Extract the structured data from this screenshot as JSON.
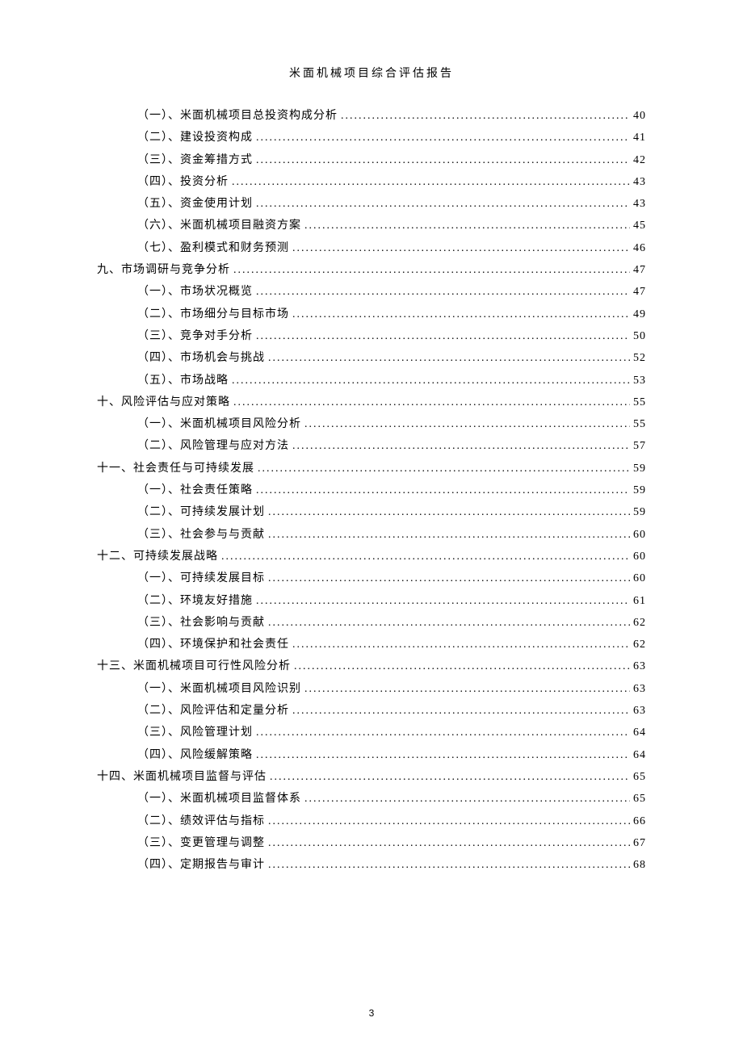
{
  "header": {
    "title": "米面机械项目综合评估报告"
  },
  "pageNumber": "3",
  "toc": [
    {
      "level": 2,
      "label": "（一）、米面机械项目总投资构成分析",
      "page": "40"
    },
    {
      "level": 2,
      "label": "（二）、建设投资构成",
      "page": "41"
    },
    {
      "level": 2,
      "label": "（三）、资金筹措方式",
      "page": "42"
    },
    {
      "level": 2,
      "label": "（四）、投资分析",
      "page": "43"
    },
    {
      "level": 2,
      "label": "（五）、资金使用计划",
      "page": "43"
    },
    {
      "level": 2,
      "label": "（六）、米面机械项目融资方案",
      "page": "45"
    },
    {
      "level": 2,
      "label": "（七）、盈利模式和财务预测",
      "page": "46"
    },
    {
      "level": 1,
      "label": "九、市场调研与竞争分析",
      "page": "47"
    },
    {
      "level": 2,
      "label": "（一）、市场状况概览",
      "page": "47"
    },
    {
      "level": 2,
      "label": "（二）、市场细分与目标市场",
      "page": "49"
    },
    {
      "level": 2,
      "label": "（三）、竞争对手分析",
      "page": "50"
    },
    {
      "level": 2,
      "label": "（四）、市场机会与挑战",
      "page": "52"
    },
    {
      "level": 2,
      "label": "（五）、市场战略",
      "page": "53"
    },
    {
      "level": 1,
      "label": "十、风险评估与应对策略",
      "page": "55"
    },
    {
      "level": 2,
      "label": "（一）、米面机械项目风险分析",
      "page": "55"
    },
    {
      "level": 2,
      "label": "（二）、风险管理与应对方法",
      "page": "57"
    },
    {
      "level": 1,
      "label": "十一、社会责任与可持续发展",
      "page": "59"
    },
    {
      "level": 2,
      "label": "（一）、社会责任策略",
      "page": "59"
    },
    {
      "level": 2,
      "label": "（二）、可持续发展计划",
      "page": "59"
    },
    {
      "level": 2,
      "label": "（三）、社会参与与贡献",
      "page": "60"
    },
    {
      "level": 1,
      "label": "十二、可持续发展战略",
      "page": "60"
    },
    {
      "level": 2,
      "label": "（一）、可持续发展目标",
      "page": "60"
    },
    {
      "level": 2,
      "label": "（二）、环境友好措施",
      "page": "61"
    },
    {
      "level": 2,
      "label": "（三）、社会影响与贡献",
      "page": "62"
    },
    {
      "level": 2,
      "label": "（四）、环境保护和社会责任",
      "page": "62"
    },
    {
      "level": 1,
      "label": "十三、米面机械项目可行性风险分析",
      "page": "63"
    },
    {
      "level": 2,
      "label": "（一）、米面机械项目风险识别",
      "page": "63"
    },
    {
      "level": 2,
      "label": "（二）、风险评估和定量分析",
      "page": "63"
    },
    {
      "level": 2,
      "label": "（三）、风险管理计划",
      "page": "64"
    },
    {
      "level": 2,
      "label": "（四）、风险缓解策略",
      "page": "64"
    },
    {
      "level": 1,
      "label": "十四、米面机械项目监督与评估",
      "page": "65"
    },
    {
      "level": 2,
      "label": "（一）、米面机械项目监督体系",
      "page": "65"
    },
    {
      "level": 2,
      "label": "（二）、绩效评估与指标",
      "page": "66"
    },
    {
      "level": 2,
      "label": "（三）、变更管理与调整",
      "page": "67"
    },
    {
      "level": 2,
      "label": "（四）、定期报告与审计",
      "page": "68"
    }
  ]
}
